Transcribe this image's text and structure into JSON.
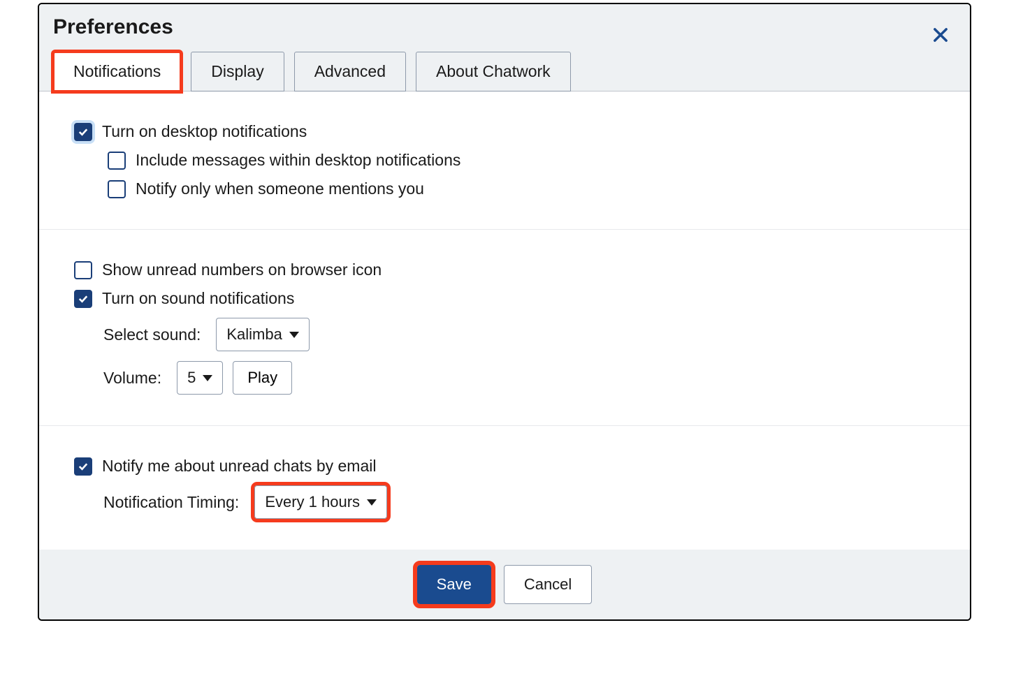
{
  "dialog": {
    "title": "Preferences"
  },
  "tabs": {
    "notifications": "Notifications",
    "display": "Display",
    "advanced": "Advanced",
    "about": "About Chatwork"
  },
  "options": {
    "desktop_notifications": {
      "label": "Turn on desktop notifications",
      "checked": true
    },
    "include_messages": {
      "label": "Include messages within desktop notifications",
      "checked": false
    },
    "notify_mentions_only": {
      "label": "Notify only when someone mentions you",
      "checked": false
    },
    "show_unread_browser_icon": {
      "label": "Show unread numbers on browser icon",
      "checked": false
    },
    "sound_notifications": {
      "label": "Turn on sound notifications",
      "checked": true
    },
    "select_sound_label": "Select sound:",
    "select_sound_value": "Kalimba",
    "volume_label": "Volume:",
    "volume_value": "5",
    "play_label": "Play",
    "notify_email": {
      "label": "Notify me about unread chats by email",
      "checked": true
    },
    "notification_timing_label": "Notification Timing:",
    "notification_timing_value": "Every 1 hours"
  },
  "footer": {
    "save": "Save",
    "cancel": "Cancel"
  }
}
